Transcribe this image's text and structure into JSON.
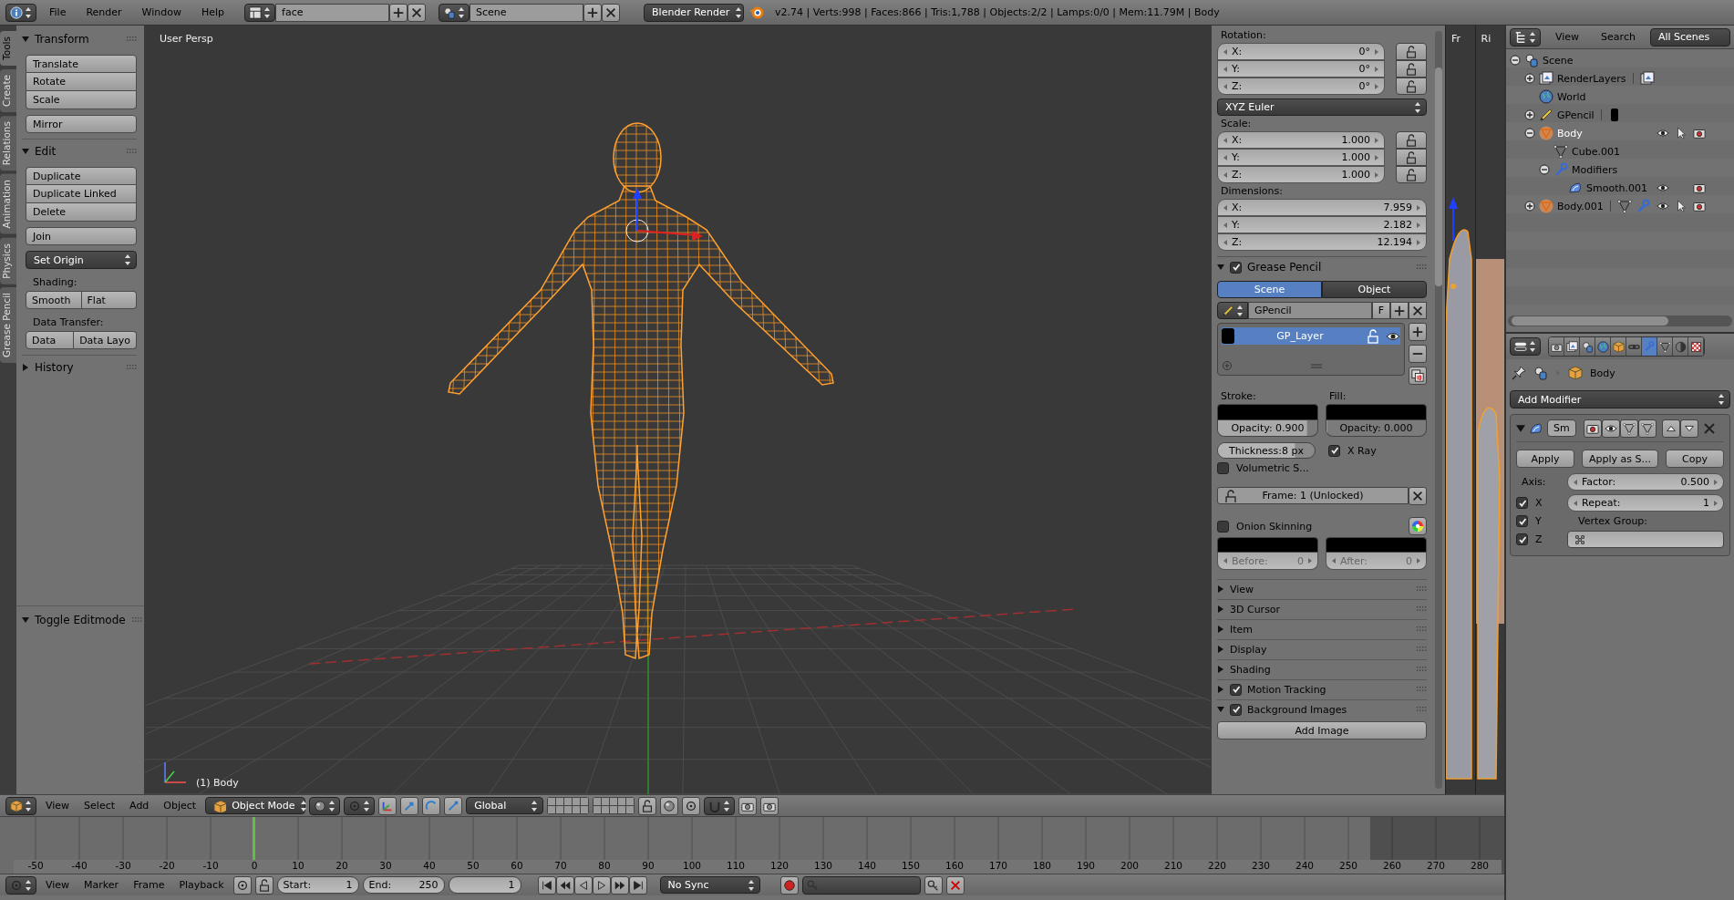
{
  "top_bar": {
    "menus": [
      "File",
      "Render",
      "Window",
      "Help"
    ],
    "screen_layout": "face",
    "scene": "Scene",
    "render_engine": "Blender Render",
    "stats": "v2.74 | Verts:998 | Faces:866 | Tris:1,788 | Objects:2/2 | Lamps:0/0 | Mem:11.79M | Body"
  },
  "tool_tabs": [
    {
      "label": "Tools",
      "selected": true
    },
    {
      "label": "Create",
      "selected": false
    },
    {
      "label": "Relations",
      "selected": false
    },
    {
      "label": "Animation",
      "selected": false
    },
    {
      "label": "Physics",
      "selected": false
    },
    {
      "label": "Grease Pencil",
      "selected": false
    }
  ],
  "tool_shelf": {
    "panels": [
      {
        "title": "Transform",
        "expanded": true,
        "items": [
          {
            "kind": "stack",
            "buttons": [
              "Translate",
              "Rotate",
              "Scale"
            ]
          },
          {
            "kind": "stack",
            "buttons": [
              "Mirror"
            ]
          }
        ]
      },
      {
        "title": "Edit",
        "expanded": true,
        "items": [
          {
            "kind": "stack",
            "buttons": [
              "Duplicate",
              "Duplicate Linked",
              "Delete"
            ]
          },
          {
            "kind": "stack",
            "buttons": [
              "Join"
            ]
          },
          {
            "kind": "dropdown",
            "label": "Set Origin"
          },
          {
            "kind": "label",
            "text": "Shading:"
          },
          {
            "kind": "row",
            "buttons": [
              "Smooth",
              "Flat"
            ]
          },
          {
            "kind": "label",
            "text": "Data Transfer:"
          },
          {
            "kind": "row",
            "buttons": [
              "Data",
              "Data Layo"
            ]
          }
        ]
      },
      {
        "title": "History",
        "expanded": false
      }
    ],
    "operator_panel": {
      "title": "Toggle Editmode",
      "expanded": true
    }
  },
  "viewport": {
    "view_label": "User Persp",
    "object_label": "(1) Body"
  },
  "properties_panel": {
    "transform_sections": [
      {
        "label": "Rotation:",
        "lock": true,
        "fields": [
          {
            "axis": "X:",
            "value": "0°"
          },
          {
            "axis": "Y:",
            "value": "0°"
          },
          {
            "axis": "Z:",
            "value": "0°"
          }
        ],
        "mode": "XYZ Euler"
      },
      {
        "label": "Scale:",
        "lock": true,
        "fields": [
          {
            "axis": "X:",
            "value": "1.000"
          },
          {
            "axis": "Y:",
            "value": "1.000"
          },
          {
            "axis": "Z:",
            "value": "1.000"
          }
        ]
      },
      {
        "label": "Dimensions:",
        "lock": false,
        "fields": [
          {
            "axis": "X:",
            "value": "7.959"
          },
          {
            "axis": "Y:",
            "value": "2.182"
          },
          {
            "axis": "Z:",
            "value": "12.194"
          }
        ]
      }
    ],
    "grease_pencil": {
      "title": "Grease Pencil",
      "checked": true,
      "expanded": true,
      "source_tabs": [
        {
          "label": "Scene",
          "selected": true
        },
        {
          "label": "Object",
          "selected": false
        }
      ],
      "datablock": "GPencil",
      "fake_user": "F",
      "layers": [
        {
          "name": "GP_Layer",
          "selected": true
        }
      ],
      "stroke": {
        "label": "Stroke:",
        "opacity": "Opacity: 0.900",
        "level": 0.9
      },
      "fill": {
        "label": "Fill:",
        "opacity": "Opacity: 0.000",
        "level": 0
      },
      "thickness": {
        "text": "Thickness:8 px",
        "level": 0.8
      },
      "xray": {
        "label": "X Ray",
        "checked": true
      },
      "volumetric": {
        "label": "Volumetric S...",
        "checked": false
      },
      "frame": "Frame: 1 (Unlocked)",
      "onion": {
        "label": "Onion Skinning",
        "checked": false
      },
      "before": {
        "label": "Before:",
        "value": "0",
        "disabled": true
      },
      "after": {
        "label": "After:",
        "value": "0",
        "disabled": true
      }
    },
    "panels": [
      {
        "title": "View",
        "kind": "plain",
        "expanded": false
      },
      {
        "title": "3D Cursor",
        "kind": "plain",
        "expanded": false
      },
      {
        "title": "Item",
        "kind": "plain",
        "expanded": false
      },
      {
        "title": "Display",
        "kind": "plain",
        "expanded": false
      },
      {
        "title": "Shading",
        "kind": "plain",
        "expanded": false
      },
      {
        "title": "Motion Tracking",
        "kind": "checkbox",
        "checked": true,
        "expanded": false
      },
      {
        "title": "Background Images",
        "kind": "checkbox",
        "checked": true,
        "expanded": true
      }
    ],
    "add_image_button": "Add Image"
  },
  "side_views": [
    {
      "label": "Fr",
      "kind": "front"
    },
    {
      "label": "Ri",
      "kind": "right"
    }
  ],
  "outliner": {
    "menus": [
      "View",
      "Search"
    ],
    "display_mode": "All Scenes",
    "tree": [
      {
        "label": "Scene",
        "kind": "scene",
        "expanded": true,
        "selected": false,
        "children": [
          {
            "label": "RenderLayers",
            "kind": "render-layers",
            "expanded": false,
            "selected": false
          },
          {
            "label": "World",
            "kind": "world",
            "selected": false
          },
          {
            "label": "GPencil",
            "kind": "grease-pencil",
            "expanded": false,
            "selected": false
          },
          {
            "label": "Body",
            "kind": "mesh-object",
            "expanded": true,
            "selected": true,
            "eye": true,
            "pointer": true,
            "camera": true,
            "children": [
              {
                "label": "Cube.001",
                "kind": "mesh-data",
                "selected": false
              },
              {
                "label": "Modifiers",
                "kind": "modifiers",
                "expanded": true,
                "selected": false,
                "children": [
                  {
                    "label": "Smooth.001",
                    "kind": "smooth-modifier",
                    "selected": false,
                    "eye": true,
                    "camera": true
                  }
                ]
              }
            ]
          },
          {
            "label": "Body.001",
            "kind": "mesh-object",
            "expanded": false,
            "selected": false,
            "eye": true,
            "pointer": true,
            "camera": true
          }
        ]
      }
    ]
  },
  "properties_editor": {
    "context_tabs": [
      {
        "kind": "render",
        "selected": false
      },
      {
        "kind": "render-layers",
        "selected": false
      },
      {
        "kind": "scene",
        "selected": false
      },
      {
        "kind": "world",
        "selected": false
      },
      {
        "kind": "object",
        "selected": false
      },
      {
        "kind": "constraints",
        "selected": false
      },
      {
        "kind": "modifiers",
        "selected": true
      },
      {
        "kind": "mesh-data",
        "selected": false
      },
      {
        "kind": "material",
        "selected": false
      },
      {
        "kind": "texture",
        "selected": false
      }
    ],
    "breadcrumb": "Body",
    "add_modifier": "Add Modifier",
    "modifier": {
      "name": "Sm",
      "expanded": true,
      "buttons": [
        "Apply",
        "Apply as S...",
        "Copy"
      ],
      "axis_label": "Axis:",
      "axes": [
        {
          "label": "X",
          "checked": true
        },
        {
          "label": "Y",
          "checked": true
        },
        {
          "label": "Z",
          "checked": true
        }
      ],
      "factor": {
        "label": "Factor:",
        "value": "0.500"
      },
      "repeat": {
        "label": "Repeat:",
        "value": "1"
      },
      "vertex_group_label": "Vertex Group:"
    }
  },
  "view3d_header": {
    "menus": [
      "View",
      "Select",
      "Add",
      "Object"
    ],
    "mode": "Object Mode",
    "orientation": "Global"
  },
  "timeline": {
    "ruler": [
      {
        "label": "-50",
        "current": false,
        "dimmed": false
      },
      {
        "label": "-40",
        "current": false,
        "dimmed": false
      },
      {
        "label": "-30",
        "current": false,
        "dimmed": false
      },
      {
        "label": "-20",
        "current": false,
        "dimmed": false
      },
      {
        "label": "-10",
        "current": false,
        "dimmed": false
      },
      {
        "label": "0",
        "current": true,
        "dimmed": false
      },
      {
        "label": "10",
        "current": false,
        "dimmed": false
      },
      {
        "label": "20",
        "current": false,
        "dimmed": false
      },
      {
        "label": "30",
        "current": false,
        "dimmed": false
      },
      {
        "label": "40",
        "current": false,
        "dimmed": false
      },
      {
        "label": "50",
        "current": false,
        "dimmed": false
      },
      {
        "label": "60",
        "current": false,
        "dimmed": false
      },
      {
        "label": "70",
        "current": false,
        "dimmed": false
      },
      {
        "label": "80",
        "current": false,
        "dimmed": false
      },
      {
        "label": "90",
        "current": false,
        "dimmed": false
      },
      {
        "label": "100",
        "current": false,
        "dimmed": false
      },
      {
        "label": "110",
        "current": false,
        "dimmed": false
      },
      {
        "label": "120",
        "current": false,
        "dimmed": false
      },
      {
        "label": "130",
        "current": false,
        "dimmed": false
      },
      {
        "label": "140",
        "current": false,
        "dimmed": false
      },
      {
        "label": "150",
        "current": false,
        "dimmed": false
      },
      {
        "label": "160",
        "current": false,
        "dimmed": false
      },
      {
        "label": "170",
        "current": false,
        "dimmed": false
      },
      {
        "label": "180",
        "current": false,
        "dimmed": false
      },
      {
        "label": "190",
        "current": false,
        "dimmed": false
      },
      {
        "label": "200",
        "current": false,
        "dimmed": false
      },
      {
        "label": "210",
        "current": false,
        "dimmed": false
      },
      {
        "label": "220",
        "current": false,
        "dimmed": false
      },
      {
        "label": "230",
        "current": false,
        "dimmed": false
      },
      {
        "label": "240",
        "current": false,
        "dimmed": false
      },
      {
        "label": "250",
        "current": false,
        "dimmed": false
      },
      {
        "label": "260",
        "current": false,
        "dimmed": true
      },
      {
        "label": "270",
        "current": false,
        "dimmed": true
      },
      {
        "label": "280",
        "current": false,
        "dimmed": true
      }
    ],
    "header": {
      "menus": [
        "View",
        "Marker",
        "Frame",
        "Playback"
      ],
      "start": {
        "label": "Start:",
        "value": "1"
      },
      "end": {
        "label": "End:",
        "value": "250"
      },
      "current_frame": "1",
      "sync": "No Sync"
    }
  }
}
